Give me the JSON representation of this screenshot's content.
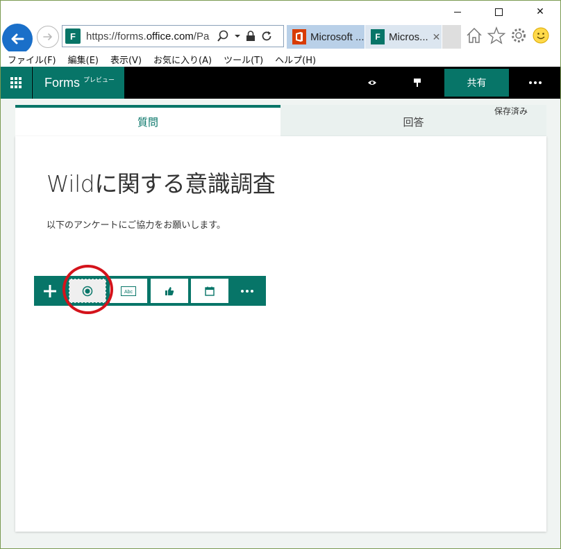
{
  "window": {
    "minimize": "",
    "maximize": "",
    "close": "✕"
  },
  "browser": {
    "url_prefix": "https://forms.",
    "url_domain": "office.com",
    "url_suffix": "/Pa",
    "tabs": [
      {
        "label": "Microsoft ...",
        "icon": "office-icon"
      },
      {
        "label": "Micros...",
        "icon": "forms-icon",
        "close": "✕"
      }
    ],
    "favicon_letter": "F"
  },
  "menu": {
    "items": [
      "ファイル(F)",
      "編集(E)",
      "表示(V)",
      "お気に入り(A)",
      "ツール(T)",
      "ヘルプ(H)"
    ]
  },
  "forms_header": {
    "brand": "Forms",
    "tag": "プレビュー",
    "share": "共有"
  },
  "tabs": {
    "questions": "質問",
    "responses": "回答"
  },
  "status": {
    "saved": "保存済み"
  },
  "form": {
    "title": "Wildに関する意識調査",
    "description": "以下のアンケートにご協力をお願いします。"
  },
  "question_toolbar": {
    "buttons": [
      {
        "name": "choice",
        "icon": "radio-icon",
        "selected": true
      },
      {
        "name": "text",
        "icon": "text-abc-icon",
        "label": "Abc"
      },
      {
        "name": "rating",
        "icon": "thumb-icon"
      },
      {
        "name": "date",
        "icon": "calendar-icon"
      }
    ]
  },
  "colors": {
    "forms_green": "#077568",
    "ie_blue": "#1a6fc9",
    "highlight_red": "#d4131b"
  }
}
